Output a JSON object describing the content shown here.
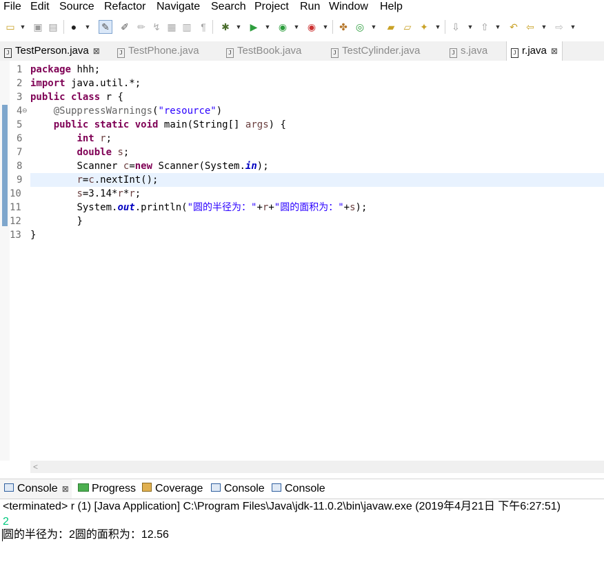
{
  "menu": [
    "File",
    "Edit",
    "Source",
    "Refactor",
    "Navigate",
    "Search",
    "Project",
    "Run",
    "Window",
    "Help"
  ],
  "tabs": [
    {
      "label": "TestPerson.java",
      "close": "⊠"
    },
    {
      "label": "TestPhone.java"
    },
    {
      "label": "TestBook.java"
    },
    {
      "label": "TestCylinder.java"
    },
    {
      "label": "s.java"
    },
    {
      "label": "r.java",
      "close": "⊠"
    }
  ],
  "editor": {
    "line_numbers": [
      "1",
      "2",
      "3",
      "4",
      "5",
      "6",
      "7",
      "8",
      "9",
      "10",
      "11",
      "12",
      "13"
    ],
    "code": {
      "l1_kw": "package",
      "l1_rest": " hhh;",
      "l2_kw": "import",
      "l2_rest": " java.util.*;",
      "l3_kw1": "public",
      "l3_kw2": "class",
      "l3_rest": " r {",
      "l4_ann": "@SuppressWarnings",
      "l4_p1": "(",
      "l4_str": "\"resource\"",
      "l4_p2": ")",
      "l5_kw1": "public",
      "l5_kw2": "static",
      "l5_kw3": "void",
      "l5_mid": " main(String[] ",
      "l5_var": "args",
      "l5_end": ") {",
      "l6_kw": "int",
      "l6_var": "r",
      "l6_end": ";",
      "l7_kw": "double",
      "l7_var": "s",
      "l7_end": ";",
      "l8_a": "Scanner ",
      "l8_var": "c",
      "l8_b": "=",
      "l8_kw": "new",
      "l8_c": " Scanner(System.",
      "l8_fld": "in",
      "l8_d": ");",
      "l9_var1": "r",
      "l9_a": "=",
      "l9_var2": "c",
      "l9_b": ".nextInt();",
      "l10_var1": "s",
      "l10_a": "=3.14*",
      "l10_var2": "r",
      "l10_b": "*",
      "l10_var3": "r",
      "l10_c": ";",
      "l11_a": "System.",
      "l11_fld": "out",
      "l11_b": ".println(",
      "l11_str1": "\"圆的半径为：\"",
      "l11_c": "+",
      "l11_var1": "r",
      "l11_d": "+",
      "l11_str2": "\"圆的面积为：\"",
      "l11_e": "+",
      "l11_var2": "s",
      "l11_f": ");",
      "l12": "}",
      "l13": "}"
    }
  },
  "console": {
    "tabs": [
      {
        "label": "Console",
        "close": "⊠"
      },
      {
        "label": "Progress"
      },
      {
        "label": "Coverage"
      },
      {
        "label": "Console"
      },
      {
        "label": "Console"
      }
    ],
    "status": "<terminated> r (1) [Java Application] C:\\Program Files\\Java\\jdk-11.0.2\\bin\\javaw.exe (2019年4月21日 下午6:27:51)",
    "input": "2",
    "output": "圆的半径为：2圆的面积为：12.56"
  },
  "colors": {
    "keyword": "#7f0055",
    "string": "#2a00ff",
    "field": "#0000c0",
    "annotation": "#646464",
    "local_var": "#6a3e3e",
    "console_input": "#00c87d",
    "current_line": "#e8f2fe"
  }
}
